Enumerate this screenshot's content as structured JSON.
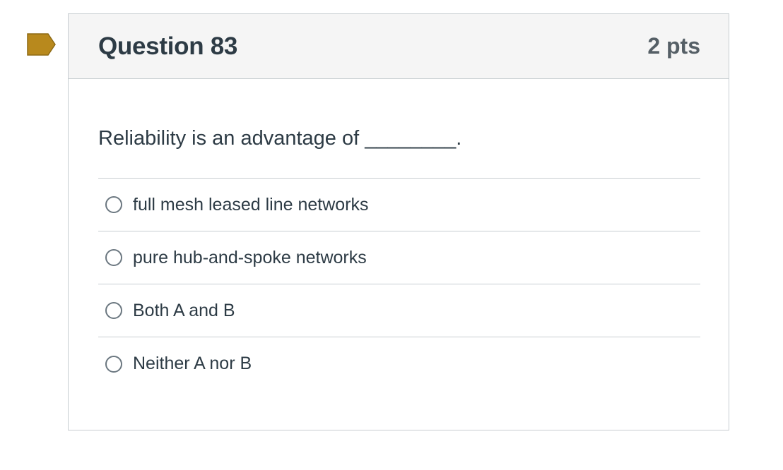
{
  "question": {
    "title": "Question 83",
    "points": "2 pts",
    "text": "Reliability is an advantage of ________.",
    "flag_color": "#b8891d",
    "flag_icon": "bookmark-flag-icon"
  },
  "answers": [
    {
      "label": "full mesh leased line networks",
      "selected": false
    },
    {
      "label": "pure hub-and-spoke networks",
      "selected": false
    },
    {
      "label": "Both A and B",
      "selected": false
    },
    {
      "label": "Neither A nor B",
      "selected": false
    }
  ]
}
